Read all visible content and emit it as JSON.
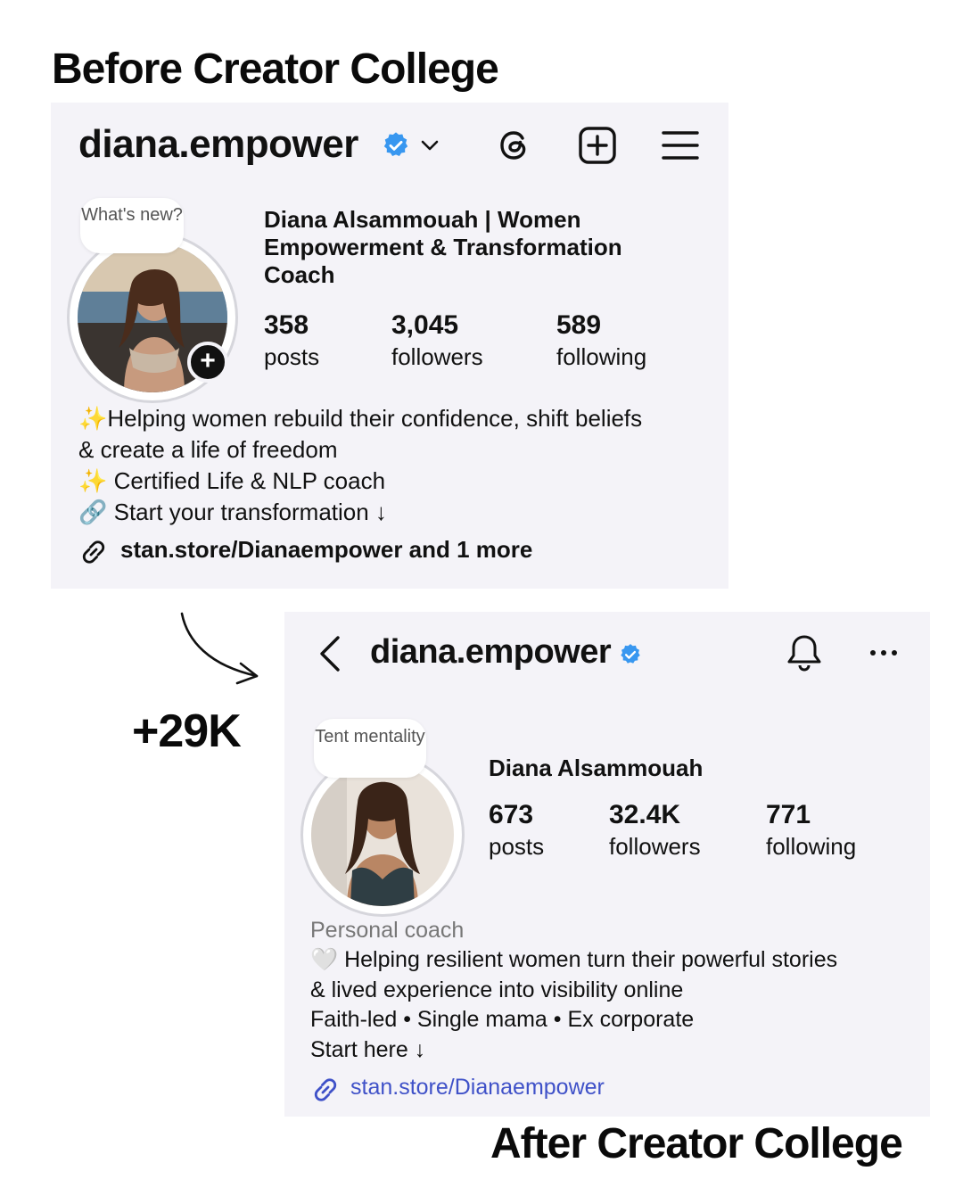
{
  "before": {
    "heading": "Before Creator College",
    "username": "diana.empower",
    "note": "What's new?",
    "display_name": "Diana Alsammouah | Women Empowerment & Transformation Coach",
    "stats": [
      {
        "value": "358",
        "label": "posts"
      },
      {
        "value": "3,045",
        "label": "followers"
      },
      {
        "value": "589",
        "label": "following"
      }
    ],
    "bio": [
      "✨Helping women rebuild their confidence, shift beliefs",
      "& create a life of freedom",
      "✨ Certified Life & NLP coach",
      "🔗 Start your transformation ↓"
    ],
    "link": "stan.store/Dianaempower and 1 more",
    "icons": [
      "verified-badge-icon",
      "chevron-down-icon",
      "threads-icon",
      "new-post-icon",
      "menu-icon",
      "add-story-icon",
      "link-icon"
    ]
  },
  "gain": "+29K",
  "after": {
    "heading": "After Creator College",
    "username": "diana.empower",
    "note": "Tent mentality",
    "display_name": "Diana Alsammouah",
    "stats": [
      {
        "value": "673",
        "label": "posts"
      },
      {
        "value": "32.4K",
        "label": "followers"
      },
      {
        "value": "771",
        "label": "following"
      }
    ],
    "category": "Personal coach",
    "bio": [
      "🤍 Helping resilient women turn their powerful stories",
      "& lived experience into visibility online",
      "Faith-led • Single mama • Ex corporate",
      "Start here ↓"
    ],
    "link": "stan.store/Dianaempower",
    "icons": [
      "back-icon",
      "verified-badge-icon",
      "bell-icon",
      "more-icon",
      "link-icon"
    ]
  },
  "colors": {
    "verified": "#3897f0",
    "link_blue": "#3f51c8",
    "card_bg": "#f4f3f8"
  }
}
